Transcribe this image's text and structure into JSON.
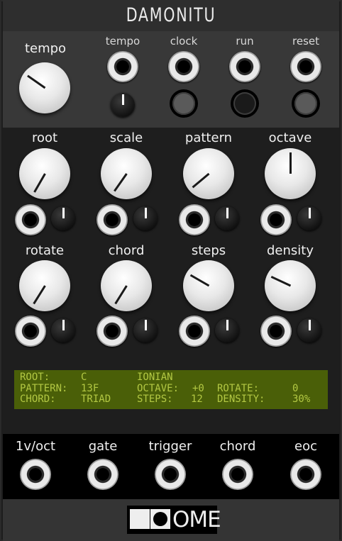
{
  "module": {
    "title": "DAMONITU"
  },
  "header": {
    "tempo_knob_label": "tempo",
    "jacks": [
      {
        "label": "tempo"
      },
      {
        "label": "clock"
      },
      {
        "label": "run"
      },
      {
        "label": "reset"
      }
    ]
  },
  "knobs": [
    {
      "label": "root"
    },
    {
      "label": "scale"
    },
    {
      "label": "pattern"
    },
    {
      "label": "octave"
    },
    {
      "label": "rotate"
    },
    {
      "label": "chord"
    },
    {
      "label": "steps"
    },
    {
      "label": "density"
    }
  ],
  "display": {
    "rows": [
      [
        "ROOT:",
        "C",
        "IONIAN",
        "",
        ""
      ],
      [
        "PATTERN:",
        "13F",
        "OCTAVE:",
        "+0",
        "ROTATE:",
        "0"
      ],
      [
        "CHORD:",
        "TRIAD",
        "STEPS:",
        "12",
        "DENSITY:",
        "30%"
      ]
    ],
    "bg_color": "#4a5f08",
    "text_color": "#b3c843"
  },
  "outputs": [
    {
      "label": "1v/oct"
    },
    {
      "label": "gate"
    },
    {
      "label": "trigger"
    },
    {
      "label": "chord"
    },
    {
      "label": "eoc"
    }
  ],
  "brand": {
    "logo_text": "OME"
  }
}
